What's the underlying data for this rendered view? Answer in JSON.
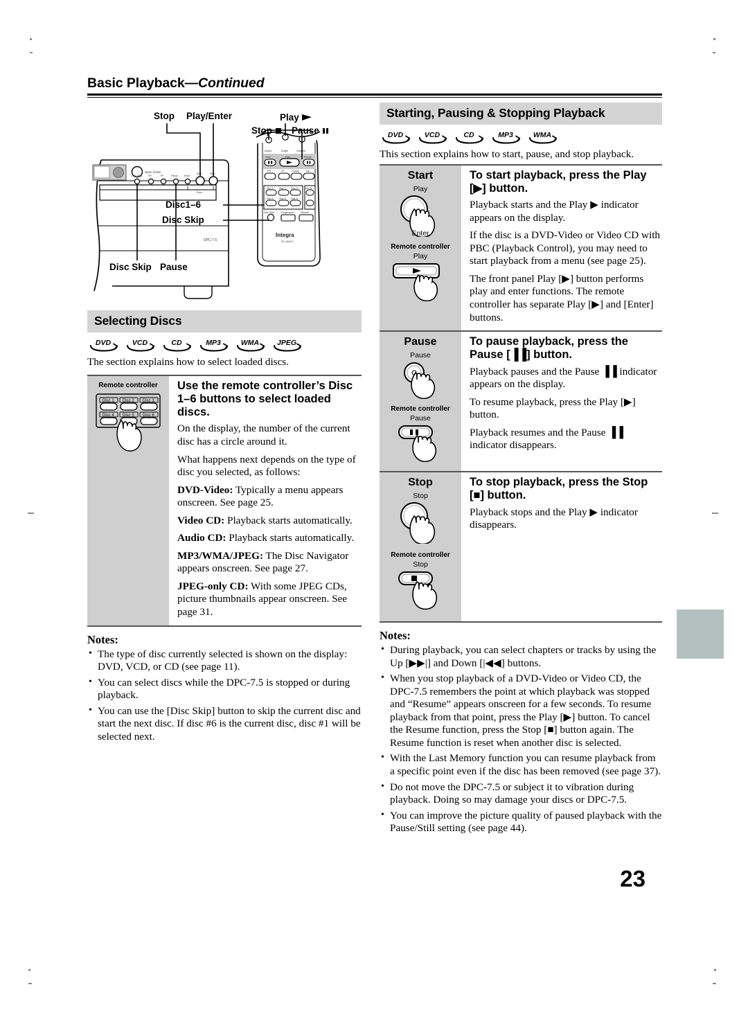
{
  "running_head": {
    "title": "Basic Playback",
    "continued": "—Continued"
  },
  "page_number": "23",
  "diagram": {
    "front_panel_labels": {
      "stop": "Stop",
      "play_enter": "Play/Enter",
      "disc_skip": "Disc Skip",
      "pause": "Pause",
      "model": "DPC-7.5",
      "open_close": "Open/Close"
    },
    "remote_labels": {
      "play": "Play",
      "stop": "Stop",
      "pause": "Pause",
      "disc1_6": "Disc1–6",
      "disc_skip": "Disc Skip",
      "brand": "Integra",
      "model": "RC-540DV"
    },
    "remote_keys": {
      "row_top": [
        "Audio",
        "Angle",
        "Subtitle"
      ],
      "row_transport": [
        "Stop",
        "Play",
        "Pause"
      ],
      "row_skip": [
        "FR",
        "FF",
        "Down",
        "Up"
      ],
      "discs": [
        "Disc 1",
        "Disc 2",
        "Disc 3",
        "Disc 4",
        "Disc 5",
        "Disc 6"
      ],
      "row_bottom": [
        "Disc Skip",
        "Progressive",
        "Dimmer"
      ],
      "disc_dir": "Disc Dir"
    }
  },
  "left": {
    "section_title": "Selecting Discs",
    "badges": [
      "DVD",
      "VCD",
      "CD",
      "MP3",
      "WMA",
      "JPEG"
    ],
    "intro": "The section explains how to select loaded discs.",
    "block": {
      "remote_label": "Remote controller",
      "disc_buttons": [
        "Disc 1",
        "Disc 2",
        "Disc 3",
        "Disc 4",
        "Disc 5",
        "Disc 6"
      ],
      "heading": "Use the remote controller’s Disc 1–6 buttons to select loaded discs.",
      "p1": "On the display, the number of the current disc has a circle around it.",
      "p2": "What happens next depends on the type of disc you selected, as follows:",
      "items": [
        {
          "term": "DVD-Video:",
          "text": " Typically a menu appears onscreen. See page 25."
        },
        {
          "term": "Video CD:",
          "text": " Playback starts automatically."
        },
        {
          "term": "Audio CD:",
          "text": " Playback starts automatically."
        },
        {
          "term": "MP3/WMA/JPEG:",
          "text": " The Disc Navigator appears onscreen. See page 27."
        },
        {
          "term": "JPEG-only CD:",
          "text": " With some JPEG CDs, picture thumbnails appear onscreen. See page 31."
        }
      ]
    },
    "notes_title": "Notes:",
    "notes": [
      "The type of disc currently selected is shown on the display: DVD, VCD, or CD (see page 11).",
      "You can select discs while the DPC-7.5 is stopped or during playback.",
      "You can use the [Disc Skip] button to skip the current disc and start the next disc. If disc #6 is the current disc, disc #1 will be selected next."
    ]
  },
  "right": {
    "section_title": "Starting, Pausing & Stopping Playback",
    "badges": [
      "DVD",
      "VCD",
      "CD",
      "MP3",
      "WMA"
    ],
    "intro": "This section explains how to start, pause, and stop playback.",
    "rows": [
      {
        "label": "Start",
        "panel_button": "Play",
        "remote_label": "Remote controller",
        "remote_button": "Play",
        "heading": "To start playback, press the Play [▶] button.",
        "paras": [
          "Playback starts and the Play ▶ indicator appears on the display.",
          "If the disc is a DVD-Video or Video CD with PBC (Playback Control), you may need to start playback from a menu (see page 25).",
          "The front panel Play [▶] button performs play and enter functions. The remote controller has separate Play [▶] and [Enter] buttons."
        ],
        "panel_sub": "Enter"
      },
      {
        "label": "Pause",
        "panel_button": "Pause",
        "remote_label": "Remote controller",
        "remote_button": "Pause",
        "heading": "To pause playback, press the Pause [▐▐] button.",
        "paras": [
          "Playback pauses and the Pause ▐▐ indicator appears on the display.",
          "To resume playback, press the Play [▶] button.",
          "Playback resumes and the Pause ▐▐ indicator disappears."
        ]
      },
      {
        "label": "Stop",
        "panel_button": "Stop",
        "remote_label": "Remote controller",
        "remote_button": "Stop",
        "heading": "To stop playback, press the Stop [■] button.",
        "paras": [
          "Playback stops and the Play ▶ indicator disappears."
        ]
      }
    ],
    "notes_title": "Notes:",
    "notes": [
      "During playback, you can select chapters or tracks by using the Up [▶▶|] and Down [|◀◀] buttons.",
      "When you stop playback of a DVD-Video or Video CD, the DPC-7.5 remembers the point at which playback was stopped and “Resume” appears onscreen for a few seconds. To resume playback from that point, press the Play [▶] button. To cancel the Resume function, press the Stop [■] button again. The Resume function is reset when another disc is selected.",
      "With the Last Memory function you can resume playback from a specific point even if the disc has been removed (see page 37).",
      "Do not move the DPC-7.5 or subject it to vibration during playback. Doing so may damage your discs or DPC-7.5.",
      "You can improve the picture quality of paused playback with the Pause/Still setting (see page 44)."
    ]
  },
  "colors": {
    "band_gray": "#d4d4d4",
    "cell_gray": "#cfcfcf",
    "edge_tab": "#b4c0c0"
  }
}
